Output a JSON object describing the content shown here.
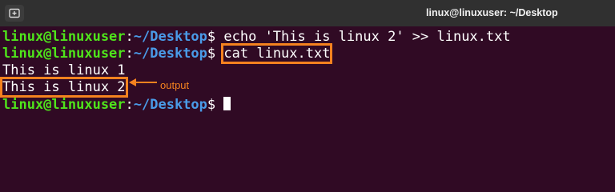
{
  "window": {
    "title": "linux@linuxuser: ~/Desktop",
    "new_tab_icon": "new-tab-icon"
  },
  "prompt": {
    "user_host": "linux@linuxuser",
    "separator": ":",
    "path": "~/Desktop",
    "symbol": "$"
  },
  "terminal": {
    "command_1": " echo 'This is linux 2' >> linux.txt",
    "command_2": "cat linux.txt",
    "output_1": "This is linux 1",
    "output_2": "This is linux 2"
  },
  "annotation": {
    "label": "output",
    "color": "#f5821f"
  },
  "colors": {
    "background": "#300a24",
    "titlebar": "#303030",
    "user_host": "#4fe41b",
    "path": "#4a9be8",
    "highlight": "#f5821f"
  }
}
